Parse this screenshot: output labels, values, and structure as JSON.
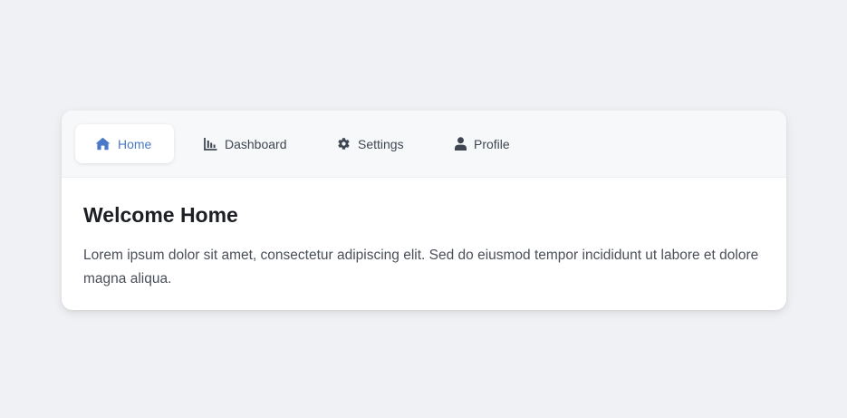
{
  "tabs": [
    {
      "label": "Home",
      "icon": "home-icon",
      "active": true
    },
    {
      "label": "Dashboard",
      "icon": "chart-icon",
      "active": false
    },
    {
      "label": "Settings",
      "icon": "gear-icon",
      "active": false
    },
    {
      "label": "Profile",
      "icon": "user-icon",
      "active": false
    }
  ],
  "content": {
    "title": "Welcome Home",
    "body": "Lorem ipsum dolor sit amet, consectetur adipiscing elit. Sed do eiusmod tempor incididunt ut labore et dolore magna aliqua."
  },
  "colors": {
    "accent": "#4a78c9",
    "background": "#f0f1f4",
    "tabbar": "#f7f8fa",
    "text": "#4a4f58"
  }
}
